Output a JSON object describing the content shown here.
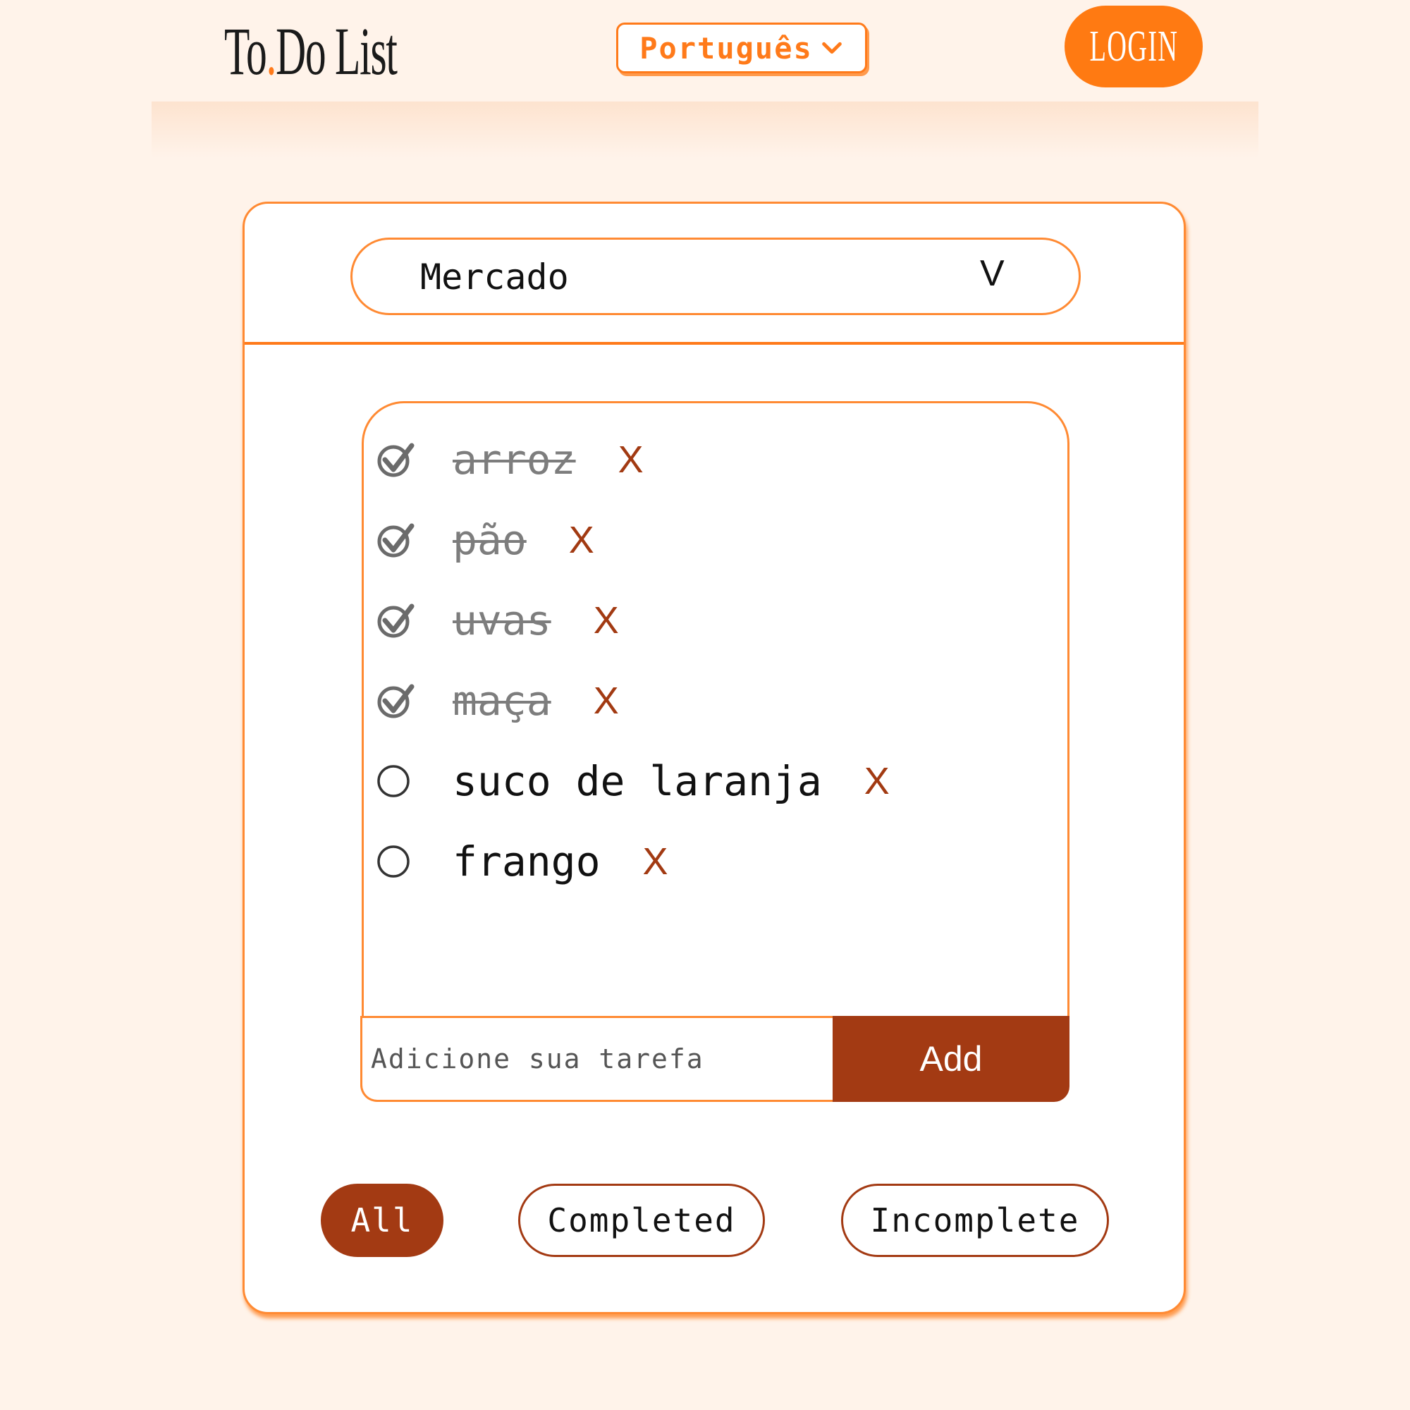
{
  "header": {
    "logo_main": "To",
    "logo_dot": ".",
    "logo_rest": "Do List",
    "language": "Português",
    "login_label": "LOGIN"
  },
  "list_selector": {
    "selected": "Mercado",
    "arrow": "V"
  },
  "todos": [
    {
      "text": "arroz",
      "done": true,
      "delete_label": "X"
    },
    {
      "text": "pão",
      "done": true,
      "delete_label": "X"
    },
    {
      "text": "uvas",
      "done": true,
      "delete_label": "X"
    },
    {
      "text": "maça",
      "done": true,
      "delete_label": "X"
    },
    {
      "text": "suco de laranja",
      "done": false,
      "delete_label": "X"
    },
    {
      "text": "frango",
      "done": false,
      "delete_label": "X"
    }
  ],
  "add_task": {
    "placeholder": "Adicione sua tarefa",
    "button_label": "Add"
  },
  "filters": {
    "all": "All",
    "completed": "Completed",
    "incomplete": "Incomplete",
    "active": "all"
  },
  "colors": {
    "background": "#fff3ea",
    "accent_orange": "#ff7a12",
    "accent_brown": "#a33a13",
    "done_text": "#7d7d7d"
  }
}
